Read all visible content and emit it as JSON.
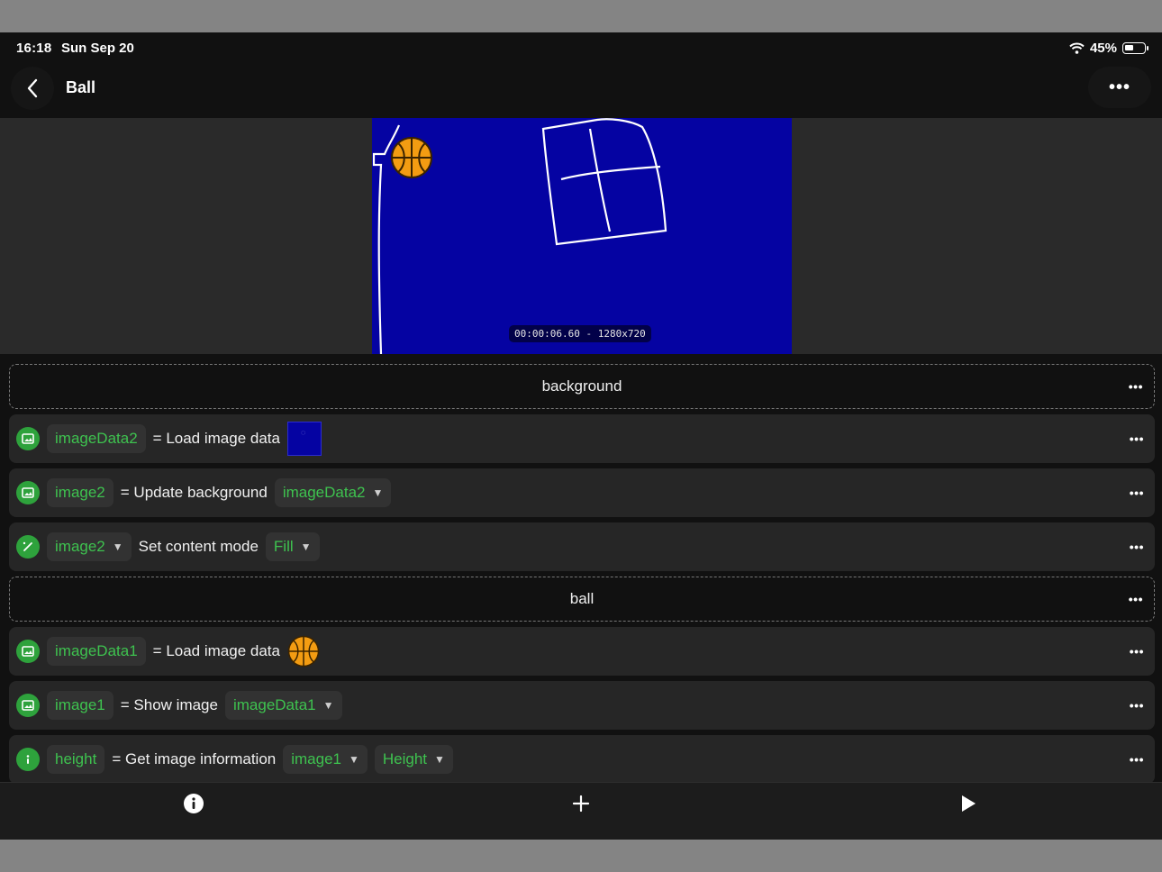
{
  "status": {
    "time": "16:18",
    "date": "Sun Sep 20",
    "battery": "45%",
    "battery_level": 0.45
  },
  "nav": {
    "title": "Ball",
    "more": "•••"
  },
  "preview": {
    "timecode": "00:00:06.60 - 1280x720"
  },
  "blocks": [
    {
      "kind": "group",
      "label": "background"
    },
    {
      "kind": "row",
      "icon": "image-icon",
      "var": "imageData2",
      "op": "= Load image data",
      "thumb": "blue-thumbnail"
    },
    {
      "kind": "row",
      "icon": "image-icon",
      "var": "image2",
      "op": "= Update background",
      "arg1": "imageData2"
    },
    {
      "kind": "row",
      "icon": "wand-icon",
      "var": "image2",
      "op": "Set content mode",
      "arg1": "Fill"
    },
    {
      "kind": "group",
      "label": "ball"
    },
    {
      "kind": "row",
      "icon": "image-icon",
      "var": "imageData1",
      "op": "= Load image data",
      "thumb": "basketball-thumbnail"
    },
    {
      "kind": "row",
      "icon": "image-icon",
      "var": "image1",
      "op": "= Show image",
      "arg1": "imageData1"
    },
    {
      "kind": "row",
      "icon": "info-icon",
      "var": "height",
      "op": "= Get image information",
      "arg1": "image1",
      "arg2": "Height"
    }
  ],
  "row_more": "•••",
  "colors": {
    "accent_green": "#3ec24f",
    "stage_blue": "#0503a2",
    "ball_orange": "#f39c12"
  },
  "tabbar": {
    "left": "info-icon",
    "center": "plus-icon",
    "right": "play-icon"
  }
}
